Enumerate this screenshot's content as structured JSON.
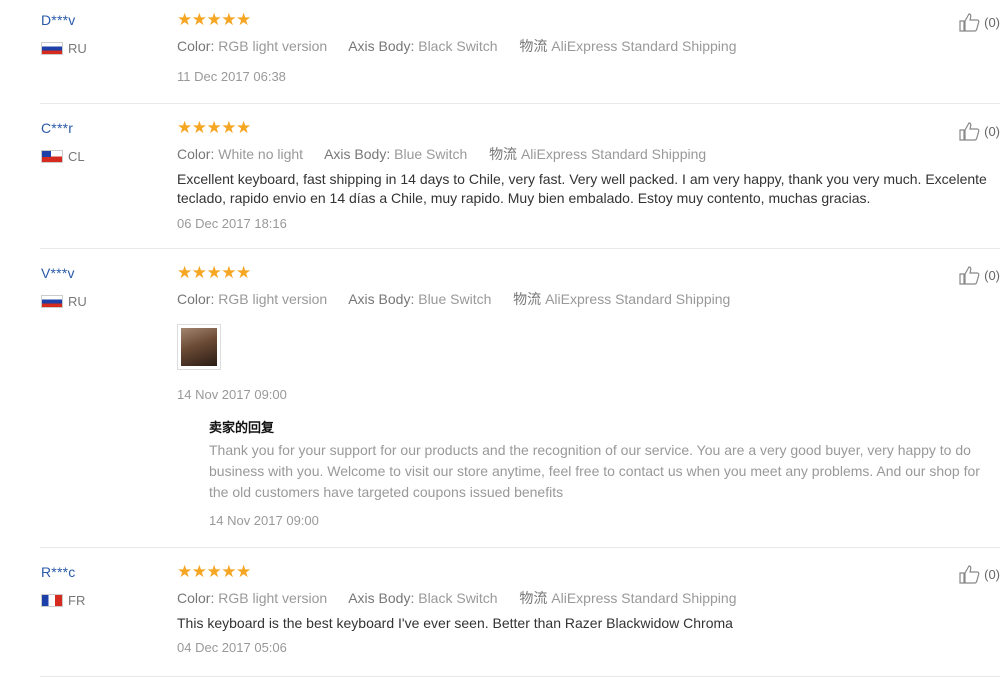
{
  "reviews": [
    {
      "user": "D***v",
      "country": "RU",
      "stars": "★★★★★",
      "attrs": [
        {
          "key": "Color:",
          "value": "RGB light version"
        },
        {
          "key": "Axis Body:",
          "value": "Black Switch"
        },
        {
          "key": "物流",
          "value": "AliExpress Standard Shipping"
        }
      ],
      "date": "11 Dec 2017 06:38",
      "helpful": "(0)"
    },
    {
      "user": "C***r",
      "country": "CL",
      "stars": "★★★★★",
      "attrs": [
        {
          "key": "Color:",
          "value": "White no light"
        },
        {
          "key": "Axis Body:",
          "value": "Blue Switch"
        },
        {
          "key": "物流",
          "value": "AliExpress Standard Shipping"
        }
      ],
      "feedback": "Excellent keyboard, fast shipping in 14 days to Chile, very fast. Very well packed. I am very happy, thank you very much. Excelente teclado, rapido envio en 14 días a Chile, muy rapido. Muy bien embalado. Estoy muy contento, muchas gracias.",
      "date": "06 Dec 2017 18:16",
      "helpful": "(0)"
    },
    {
      "user": "V***v",
      "country": "RU",
      "stars": "★★★★★",
      "attrs": [
        {
          "key": "Color:",
          "value": "RGB light version"
        },
        {
          "key": "Axis Body:",
          "value": "Blue Switch"
        },
        {
          "key": "物流",
          "value": "AliExpress Standard Shipping"
        }
      ],
      "date": "14 Nov 2017 09:00",
      "reply": {
        "title": "卖家的回复",
        "text": "Thank you for your support for our products and the recognition of our service. You are a very good buyer, very happy to do business with you. Welcome to visit our store anytime, feel free to contact us when you meet any problems. And our shop for the old customers have targeted coupons issued benefits",
        "date": "14 Nov 2017 09:00"
      },
      "helpful": "(0)"
    },
    {
      "user": "R***c",
      "country": "FR",
      "stars": "★★★★★",
      "attrs": [
        {
          "key": "Color:",
          "value": "RGB light version"
        },
        {
          "key": "Axis Body:",
          "value": "Black Switch"
        },
        {
          "key": "物流",
          "value": "AliExpress Standard Shipping"
        }
      ],
      "feedback": "This keyboard is the best keyboard I've ever seen. Better than Razer Blackwidow Chroma",
      "date": "04 Dec 2017 05:06",
      "helpful": "(0)"
    }
  ]
}
